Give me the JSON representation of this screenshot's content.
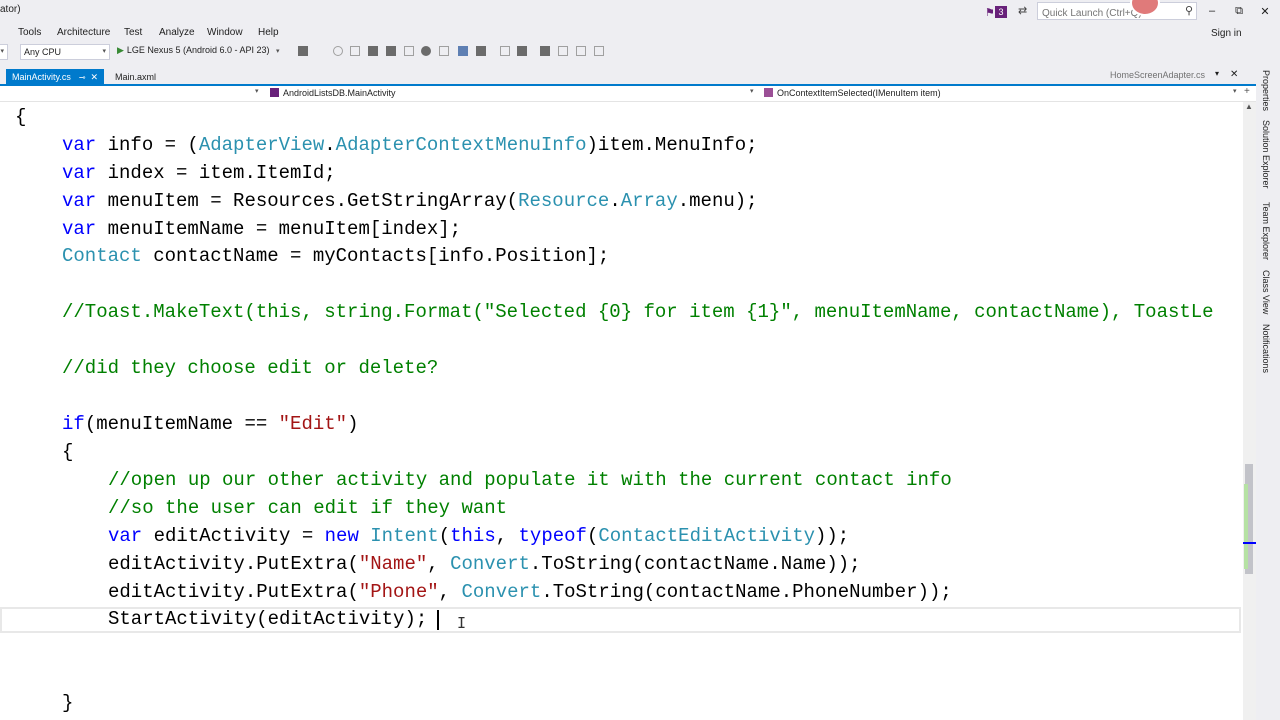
{
  "window": {
    "title_fragment": "ator)",
    "notification_count": "3",
    "quick_launch_placeholder": "Quick Launch (Ctrl+Q)",
    "sign_in": "Sign in"
  },
  "menu": [
    "Tools",
    "Architecture",
    "Test",
    "Analyze",
    "Window",
    "Help"
  ],
  "toolbar": {
    "platform": "Any CPU",
    "run_target": "LGE Nexus 5 (Android 6.0 - API 23)"
  },
  "tabs": {
    "active": "MainActivity.cs",
    "second": "Main.axml",
    "right": "HomeScreenAdapter.cs"
  },
  "navbar": {
    "type_member": "AndroidListsDB.MainActivity",
    "method": "OnContextItemSelected(IMenuItem item)"
  },
  "sidebar": [
    "Properties",
    "Solution Explorer",
    "Team Explorer",
    "Class View",
    "Notifications"
  ],
  "code": {
    "l1": "{",
    "l2_kw": "var",
    "l2_a": " info = (",
    "l2_t1": "AdapterView",
    "l2_b": ".",
    "l2_t2": "AdapterContextMenuInfo",
    "l2_c": ")item.MenuInfo;",
    "l3_kw": "var",
    "l3_a": " index = item.ItemId;",
    "l4_kw": "var",
    "l4_a": " menuItem = Resources.GetStringArray(",
    "l4_t1": "Resource",
    "l4_b": ".",
    "l4_t2": "Array",
    "l4_c": ".menu);",
    "l5_kw": "var",
    "l5_a": " menuItemName = menuItem[index];",
    "l6_t": "Contact",
    "l6_a": " contactName = myContacts[info.Position];",
    "l7": "//Toast.MakeText(this, string.Format(\"Selected {0} for item {1}\", menuItemName, contactName), ToastLe",
    "l8": "//did they choose edit or delete?",
    "l9_kw": "if",
    "l9_a": "(menuItemName == ",
    "l9_s": "\"Edit\"",
    "l9_b": ")",
    "l10": "{",
    "l11": "//open up our other activity and populate it with the current contact info",
    "l12": "//so the user can edit if they want",
    "l13_kw": "var",
    "l13_a": " editActivity = ",
    "l13_kw2": "new",
    "l13_b": " ",
    "l13_t": "Intent",
    "l13_c": "(",
    "l13_kw3": "this",
    "l13_d": ", ",
    "l13_kw4": "typeof",
    "l13_e": "(",
    "l13_t2": "ContactEditActivity",
    "l13_f": "));",
    "l14_a": "editActivity.PutExtra(",
    "l14_s": "\"Name\"",
    "l14_b": ", ",
    "l14_t": "Convert",
    "l14_c": ".ToString(contactName.Name));",
    "l15_a": "editActivity.PutExtra(",
    "l15_s": "\"Phone\"",
    "l15_b": ", ",
    "l15_t": "Convert",
    "l15_c": ".ToString(contactName.PhoneNumber));",
    "l16": "StartActivity(editActivity);",
    "l17": "}"
  }
}
